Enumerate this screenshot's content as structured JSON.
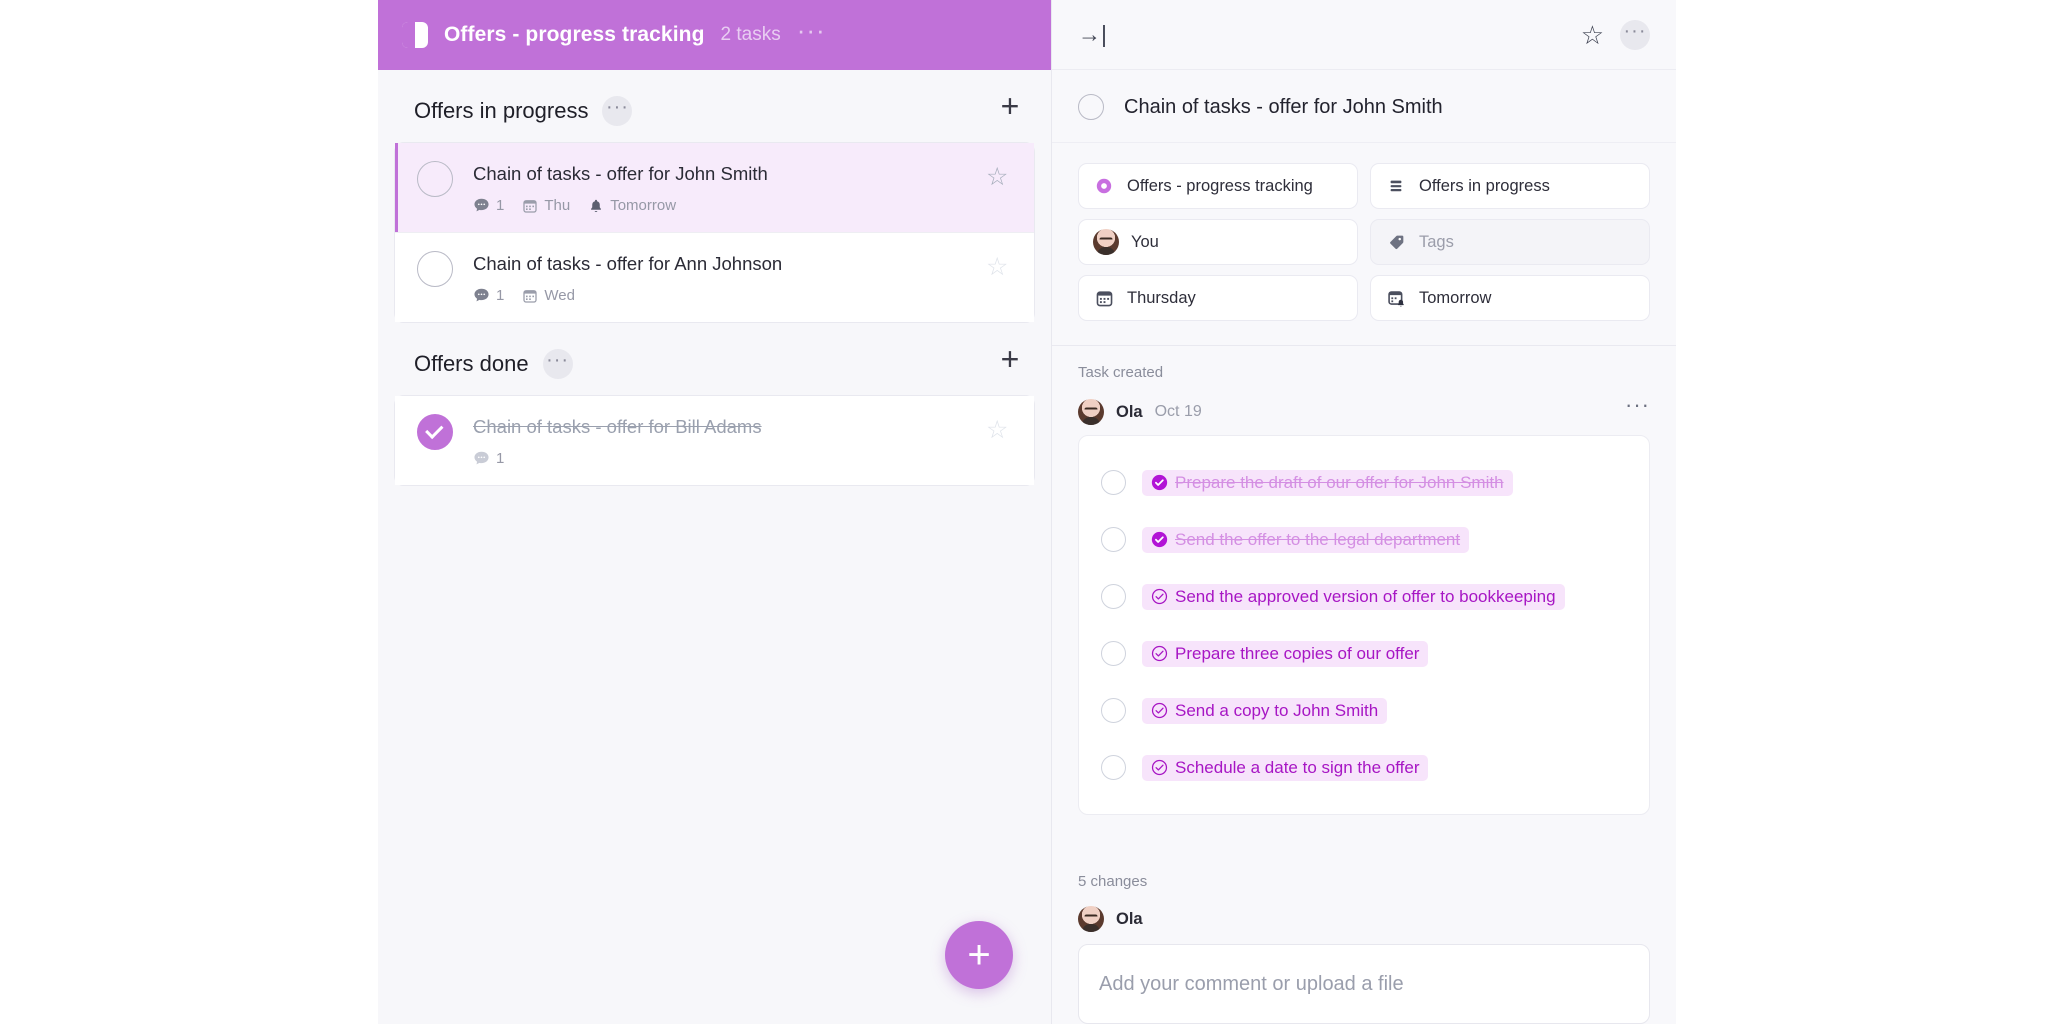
{
  "board": {
    "icon": "board-split-icon",
    "title": "Offers - progress tracking",
    "task_count": "2 tasks",
    "more": "···"
  },
  "groups": [
    {
      "title": "Offers in progress",
      "more": "···",
      "add": "+",
      "tasks": [
        {
          "title": "Chain of tasks - offer for John Smith",
          "done": false,
          "selected": true,
          "comments": "1",
          "date": "Thu",
          "reminder": "Tomorrow",
          "star": "☆"
        },
        {
          "title": "Chain of tasks - offer for Ann Johnson",
          "done": false,
          "selected": false,
          "comments": "1",
          "date": "Wed",
          "reminder": "",
          "star": "☆"
        }
      ]
    },
    {
      "title": "Offers done",
      "more": "···",
      "add": "+",
      "tasks": [
        {
          "title": "Chain of tasks - offer for Bill Adams",
          "done": true,
          "selected": false,
          "comments": "1",
          "date": "",
          "reminder": "",
          "star": "☆"
        }
      ]
    }
  ],
  "fab": {
    "label": "+"
  },
  "detail": {
    "collapse_icon": "→|",
    "star_icon": "☆",
    "more": "···",
    "title": "Chain of tasks - offer for John Smith",
    "chips": [
      {
        "name": "board",
        "label": "Offers - progress tracking",
        "icon": "board-dot-icon",
        "empty": false
      },
      {
        "name": "section",
        "label": "Offers in progress",
        "icon": "list-icon",
        "empty": false
      },
      {
        "name": "assignee",
        "label": "You",
        "icon": "avatar-icon",
        "empty": false
      },
      {
        "name": "tags",
        "label": "Tags",
        "icon": "tag-icon",
        "empty": true
      },
      {
        "name": "due-date",
        "label": "Thursday",
        "icon": "calendar-icon",
        "empty": false
      },
      {
        "name": "reminder",
        "label": "Tomorrow",
        "icon": "calendar-bell-icon",
        "empty": false
      }
    ],
    "activity_label": "Task created",
    "author": "Ola",
    "author_date": "Oct 19",
    "subtasks": [
      {
        "label": "Prepare the draft of our offer for John Smith",
        "done": true
      },
      {
        "label": "Send the offer to the legal department",
        "done": true
      },
      {
        "label": "Send the approved version of offer to bookkeeping",
        "done": false
      },
      {
        "label": "Prepare three copies of our offer",
        "done": false
      },
      {
        "label": "Send a copy to John Smith",
        "done": false
      },
      {
        "label": "Schedule a date to sign the offer",
        "done": false
      }
    ],
    "changes": "5 changes",
    "comment_author": "Ola",
    "comment_placeholder": "Add your comment or upload a file"
  },
  "colors": {
    "accent": "#c071d8",
    "selected_row": "#f7ebfb",
    "pill_bg": "#f7e4fb",
    "pill_text": "#a716c4",
    "pill_done_text": "#d48fe3"
  }
}
